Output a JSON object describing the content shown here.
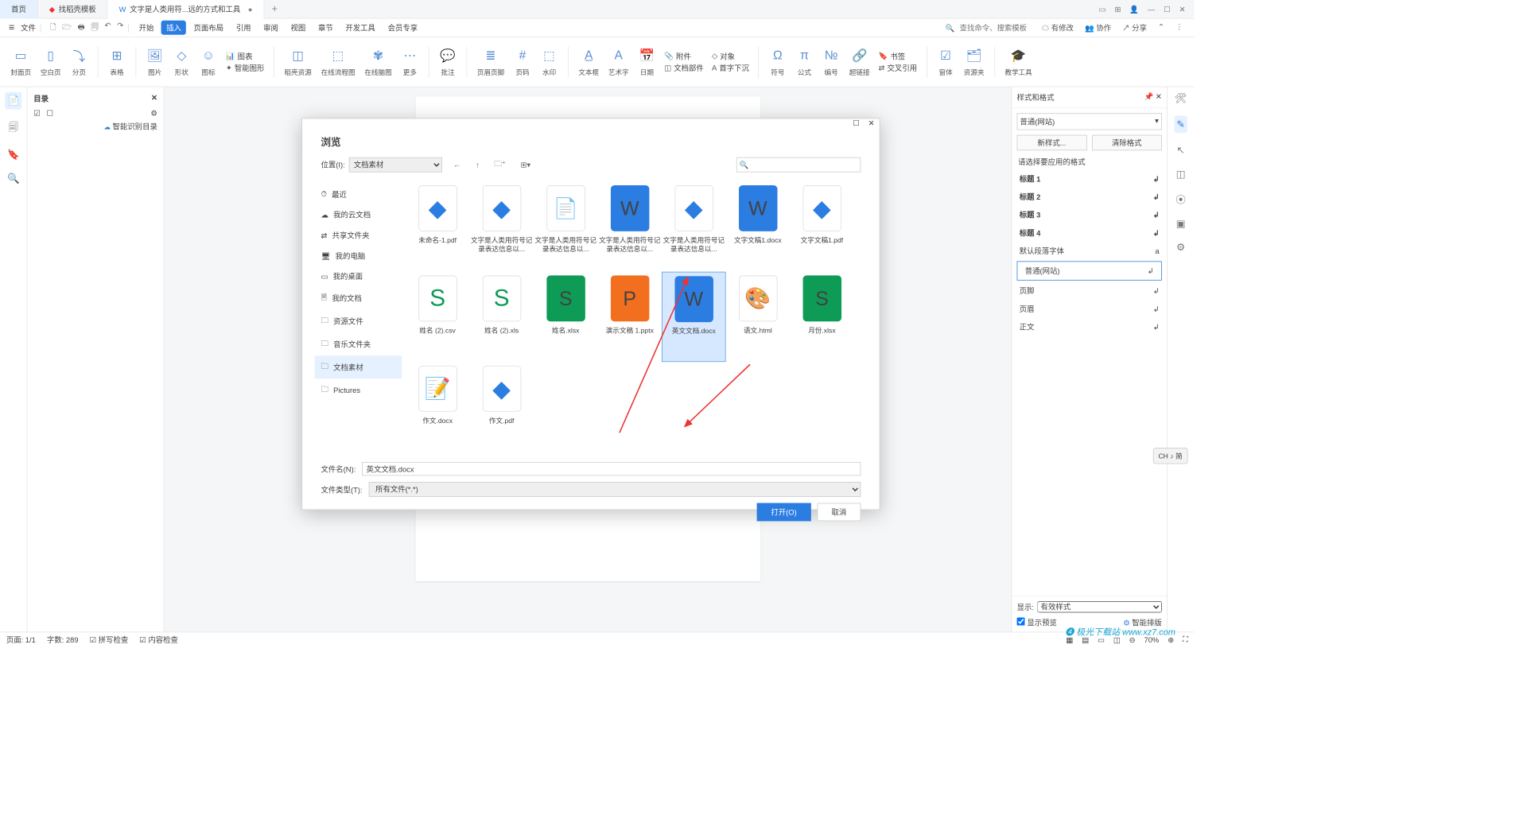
{
  "tabs": {
    "home": "首页",
    "template": "找稻壳模板",
    "doc": "文字是人类用符...远的方式和工具"
  },
  "menu": {
    "file": "文件",
    "items": [
      "开始",
      "插入",
      "页面布局",
      "引用",
      "审阅",
      "视图",
      "章节",
      "开发工具",
      "会员专享"
    ],
    "search_ph": "查找命令、搜索模板",
    "cloud": [
      "有修改",
      "协作",
      "分享"
    ]
  },
  "ribbon": [
    {
      "lbl": "封面页"
    },
    {
      "lbl": "空白页"
    },
    {
      "lbl": "分页"
    },
    {
      "lbl": "表格"
    },
    {
      "lbl": "图片"
    },
    {
      "lbl": "形状"
    },
    {
      "lbl": "图标"
    },
    {
      "lbl": "稻壳资源"
    },
    {
      "lbl": "在线流程图"
    },
    {
      "lbl": "在线脑图"
    },
    {
      "lbl": "更多"
    },
    {
      "lbl": "批注"
    },
    {
      "lbl": "页眉页脚"
    },
    {
      "lbl": "页码"
    },
    {
      "lbl": "水印"
    },
    {
      "lbl": "文本框"
    },
    {
      "lbl": "艺术字"
    },
    {
      "lbl": "日期"
    },
    {
      "lbl": "符号"
    },
    {
      "lbl": "公式"
    },
    {
      "lbl": "编号"
    },
    {
      "lbl": "超链接"
    },
    {
      "lbl": "窗体"
    },
    {
      "lbl": "资源夹"
    },
    {
      "lbl": "教学工具"
    }
  ],
  "ribbon_small": {
    "chart": "图表",
    "smart": "智能图形",
    "att": "附件",
    "docpart": "文档部件",
    "obj": "对象",
    "capital": "首字下沉",
    "bm": "书签",
    "xref": "交叉引用"
  },
  "outline": {
    "title": "目录",
    "smart": "智能识别目录"
  },
  "stylepane": {
    "title": "样式和格式",
    "current": "普通(网站)",
    "new": "新样式...",
    "clear": "清除格式",
    "prompt": "请选择要应用的格式",
    "items": [
      "标题 1",
      "标题 2",
      "标题 3",
      "标题 4",
      "默认段落字体",
      "普通(网站)",
      "页脚",
      "页眉",
      "正文"
    ],
    "show_lbl": "显示:",
    "show_val": "有效样式",
    "preview": "显示预览",
    "smart": "智能排版"
  },
  "status": {
    "page": "页面: 1/1",
    "words": "字数: 289",
    "spell": "拼写检查",
    "content": "内容检查",
    "zoom": "70%"
  },
  "ime": "CH ♪ 简",
  "dialog": {
    "title": "浏览",
    "loc_lbl": "位置(I):",
    "loc_val": "文档素材",
    "side": [
      {
        "ico": "⏱",
        "lbl": "最近"
      },
      {
        "ico": "☁",
        "lbl": "我的云文档"
      },
      {
        "ico": "⇄",
        "lbl": "共享文件夹"
      },
      {
        "ico": "🖥",
        "lbl": "我的电脑"
      },
      {
        "ico": "▭",
        "lbl": "我的桌面"
      },
      {
        "ico": "🗎",
        "lbl": "我的文档"
      },
      {
        "ico": "🗀",
        "lbl": "资源文件"
      },
      {
        "ico": "🗀",
        "lbl": "音乐文件夹"
      },
      {
        "ico": "🗀",
        "lbl": "文档素材",
        "active": true
      },
      {
        "ico": "🗀",
        "lbl": "Pictures"
      }
    ],
    "files": [
      {
        "name": "未命名-1.pdf",
        "icon": "cloud"
      },
      {
        "name": "文字是人类用符号记录表达信息以...",
        "icon": "cloud"
      },
      {
        "name": "文字是人类用符号记录表达信息以...",
        "icon": "blank"
      },
      {
        "name": "文字是人类用符号记录表达信息以...",
        "icon": "w"
      },
      {
        "name": "文字是人类用符号记录表达信息以...",
        "icon": "cloud"
      },
      {
        "name": "文字文稿1.docx",
        "icon": "w"
      },
      {
        "name": "文字文稿1.pdf",
        "icon": "cloud"
      },
      {
        "name": "姓名 (2).csv",
        "icon": "s"
      },
      {
        "name": "姓名 (2).xls",
        "icon": "s"
      },
      {
        "name": "姓名.xlsx",
        "icon": "sg"
      },
      {
        "name": "演示文稿 1.pptx",
        "icon": "p"
      },
      {
        "name": "英文文档.docx",
        "icon": "w",
        "selected": true
      },
      {
        "name": "语文.html",
        "icon": "color"
      },
      {
        "name": "月份.xlsx",
        "icon": "sg"
      },
      {
        "name": "作文.docx",
        "icon": "thumb"
      },
      {
        "name": "作文.pdf",
        "icon": "cloud"
      }
    ],
    "fname_lbl": "文件名(N):",
    "fname_val": "英文文档.docx",
    "ftype_lbl": "文件类型(T):",
    "ftype_val": "所有文件(*.*)",
    "open": "打开(O)",
    "cancel": "取消"
  },
  "wm": "❹ 极光下载站\nwww.xz7.com"
}
